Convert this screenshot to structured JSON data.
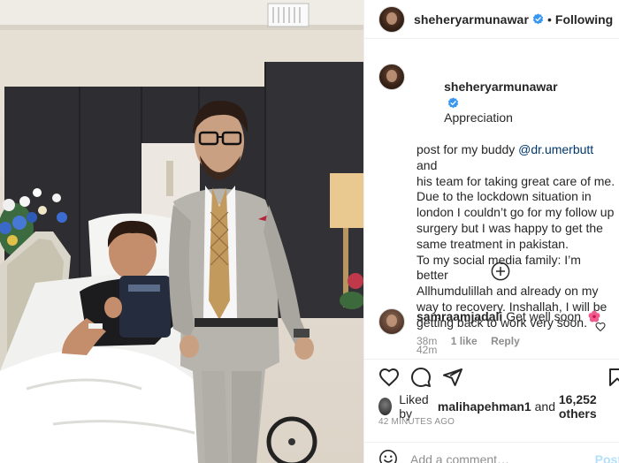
{
  "post": {
    "username": "sheheryarmunawar",
    "follow_separator": "•",
    "follow_label": "Following",
    "caption_lines": [
      "Appreciation",
      "post for my buddy ",
      "his team for taking great care of me.",
      "Due to the lockdown situation in",
      "london I couldn’t go for my follow up",
      "surgery but I was happy to get the",
      "same treatment in pakistan.",
      "To my social media family: I’m better",
      "Allhumdulillah and already on my",
      "way to recovery. Inshallah, I will be",
      "getting back to work very soon."
    ],
    "mention": "@dr.umerbutt",
    "after_mention": " and",
    "time": "42m"
  },
  "comment": {
    "username": "samraamjadali",
    "text": "Get well soon",
    "time": "38m",
    "likes": "1 like",
    "reply": "Reply"
  },
  "likes": {
    "prefix": "Liked by ",
    "user": "malihарehman1",
    "middle": " and ",
    "count": "16,252 others"
  },
  "timestamp": "42 MINUTES AGO",
  "add_comment": {
    "placeholder": "Add a comment…",
    "post_label": "Post"
  },
  "colors": {
    "text": "#262626",
    "muted": "#8e8e8e",
    "link": "#00376b",
    "verified": "#3897f0",
    "post_disabled": "#b2dffc"
  }
}
